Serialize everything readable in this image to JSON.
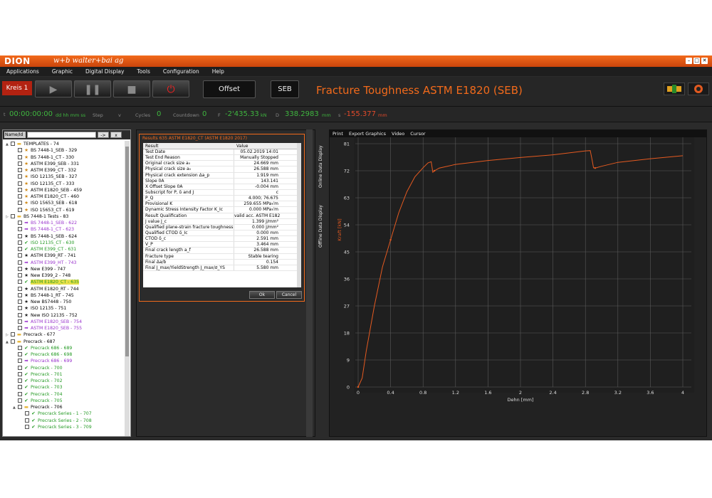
{
  "window": {
    "logo": "DION",
    "brand": "w+b  walter+bai ag"
  },
  "menu": [
    "Applications",
    "Graphic",
    "Digital Display",
    "Tools",
    "Configuration",
    "Help"
  ],
  "toolbar": {
    "kreis": "Kreis 1",
    "offset": "Offset",
    "seb": "SEB",
    "title": "Fracture Toughness ASTM E1820 (SEB)"
  },
  "status": {
    "t_label": "t",
    "time": "00:00:00:00",
    "time_unit": "dd hh mm ss",
    "step_label": "Step",
    "step_sub": "v",
    "cycles_label": "Cycles",
    "cycles": "0",
    "countdown_label": "Countdown",
    "countdown": "0",
    "f_label": "F",
    "f_value": "-2'435.33",
    "f_unit": "kN",
    "d_label": "D",
    "d_value": "338.2983",
    "d_unit": "mm",
    "s_label": "s",
    "s_value": "-155.377",
    "s_unit": "mm"
  },
  "left": {
    "search_label": "Name/Id",
    "btn_go": "->",
    "btn_clear": "x",
    "tree": [
      {
        "level": 0,
        "exp": "▲",
        "icon": "folder",
        "text": "TEMPLATES - 74",
        "color": ""
      },
      {
        "level": 1,
        "icon": "star",
        "text": "BS 7448-1_SEB - 329",
        "color": ""
      },
      {
        "level": 1,
        "icon": "star",
        "text": "BS 7448-1_CT - 330",
        "color": ""
      },
      {
        "level": 1,
        "icon": "star",
        "text": "ASTM E399_SEB - 331",
        "color": ""
      },
      {
        "level": 1,
        "icon": "star",
        "text": "ASTM E399_CT - 332",
        "color": ""
      },
      {
        "level": 1,
        "icon": "star",
        "text": "ISO 12135_SEB - 327",
        "color": ""
      },
      {
        "level": 1,
        "icon": "star",
        "text": "ISO 12135_CT - 333",
        "color": ""
      },
      {
        "level": 1,
        "icon": "star",
        "text": "ASTM E1820_SEB - 459",
        "color": ""
      },
      {
        "level": 1,
        "icon": "star",
        "text": "ASTM E1820_CT - 460",
        "color": ""
      },
      {
        "level": 1,
        "icon": "star",
        "text": "ISO 15653_SEB - 618",
        "color": ""
      },
      {
        "level": 1,
        "icon": "star",
        "text": "ISO 15653_CT - 619",
        "color": ""
      },
      {
        "level": 0,
        "exp": "▷",
        "icon": "folder",
        "text": "BS 7448-1 Tests - 83",
        "color": ""
      },
      {
        "level": 1,
        "icon": "arrow",
        "text": "BS 7448-1_SEB - 622",
        "color": "purple"
      },
      {
        "level": 1,
        "icon": "arrow",
        "text": "BS 7448-1_CT - 623",
        "color": "purple"
      },
      {
        "level": 1,
        "icon": "blackstar",
        "text": "BS 7448-1_SEB - 624",
        "color": ""
      },
      {
        "level": 1,
        "icon": "check",
        "text": "ISO 12135_CT - 630",
        "color": "green"
      },
      {
        "level": 1,
        "icon": "check",
        "text": "ASTM E399_CT - 631",
        "color": "green"
      },
      {
        "level": 1,
        "icon": "blackstar",
        "text": "ASTM E399_RT - 741",
        "color": ""
      },
      {
        "level": 1,
        "icon": "arrow",
        "text": "ASTM E399_HT - 743",
        "color": "purple"
      },
      {
        "level": 1,
        "icon": "blackstar",
        "text": "New E399 - 747",
        "color": ""
      },
      {
        "level": 1,
        "icon": "blackstar",
        "text": "New E399_2 - 748",
        "color": ""
      },
      {
        "level": 1,
        "icon": "check",
        "text": "ASTM E1820_CT - 635",
        "color": "green",
        "selected": true
      },
      {
        "level": 1,
        "icon": "blackstar",
        "text": "ASTM E1820_RT - 744",
        "color": ""
      },
      {
        "level": 1,
        "icon": "blackstar",
        "text": "BS 7448-1_RT - 745",
        "color": ""
      },
      {
        "level": 1,
        "icon": "blackstar",
        "text": "New BS7448 - 750",
        "color": ""
      },
      {
        "level": 1,
        "icon": "blackstar",
        "text": "ISO 12135 - 751",
        "color": ""
      },
      {
        "level": 1,
        "icon": "blackstar",
        "text": "New ISO 12135 - 752",
        "color": ""
      },
      {
        "level": 1,
        "icon": "arrow",
        "text": "ASTM E1820_SEB - 754",
        "color": "purple"
      },
      {
        "level": 1,
        "icon": "arrow",
        "text": "ASTM E1820_SEB - 755",
        "color": "purple"
      },
      {
        "level": 0,
        "exp": "▷",
        "icon": "folder",
        "text": "Precrack - 677",
        "color": ""
      },
      {
        "level": 0,
        "exp": "▲",
        "icon": "folder",
        "text": "Precrack - 687",
        "color": ""
      },
      {
        "level": 1,
        "icon": "check",
        "text": "Precrack 686 - 689",
        "color": "green"
      },
      {
        "level": 1,
        "icon": "check",
        "text": "Precrack 686 - 698",
        "color": "green"
      },
      {
        "level": 1,
        "icon": "arrow",
        "text": "Precrack 686 - 699",
        "color": "purple"
      },
      {
        "level": 1,
        "icon": "check",
        "text": "Precrack - 700",
        "color": "green"
      },
      {
        "level": 1,
        "icon": "check",
        "text": "Precrack - 701",
        "color": "green"
      },
      {
        "level": 1,
        "icon": "check",
        "text": "Precrack - 702",
        "color": "green"
      },
      {
        "level": 1,
        "icon": "check",
        "text": "Precrack - 703",
        "color": "green"
      },
      {
        "level": 1,
        "icon": "check",
        "text": "Precrack - 704",
        "color": "green"
      },
      {
        "level": 1,
        "icon": "check",
        "text": "Precrack - 705",
        "color": "green"
      },
      {
        "level": 1,
        "exp": "▲",
        "icon": "folder",
        "text": "Precrack - 706",
        "color": ""
      },
      {
        "level": 2,
        "icon": "check",
        "text": "Precrack Series - 1 - 707",
        "color": "green"
      },
      {
        "level": 2,
        "icon": "check",
        "text": "Precrack Series - 2 - 708",
        "color": "green"
      },
      {
        "level": 2,
        "icon": "check",
        "text": "Precrack Series - 3 - 709",
        "color": "green"
      }
    ]
  },
  "dialog": {
    "title": "Results 635 ASTM E1820_CT (ASTM E1820 2017)",
    "header": {
      "k": "Result",
      "v": "Value"
    },
    "rows": [
      {
        "k": "Test Date",
        "v": "05.02.2019 14:01"
      },
      {
        "k": "Test End Reason",
        "v": "Manually Stopped"
      },
      {
        "k": "Original crack size a₀",
        "v": "24.669 mm"
      },
      {
        "k": "Physical crack size a₀",
        "v": "26.588 mm"
      },
      {
        "k": "Physical crack extension Δa_p",
        "v": "1.919 mm"
      },
      {
        "k": "Slope 0A",
        "v": "143.141"
      },
      {
        "k": "X Offset Slope 0A",
        "v": "-0.004 mm"
      },
      {
        "k": "Subscript for P, δ and J",
        "v": "c"
      },
      {
        "k": "P_Q",
        "v": "4.000; 76.675"
      },
      {
        "k": "Provisional K",
        "v": "259.655 MPa√m"
      },
      {
        "k": "Dynamic Stress Intensity Factor K_Ic",
        "v": "0.000 MPa√m"
      },
      {
        "k": "Result Qualification",
        "v": "valid acc. ASTM E1820"
      },
      {
        "k": "J value J_c",
        "v": "1.399 J/mm²"
      },
      {
        "k": "Qualified plane-strain fracture toughness J_Ic",
        "v": "0.000 J/mm²"
      },
      {
        "k": "Qualified CTOD δ_Ic",
        "v": "0.000 mm"
      },
      {
        "k": "CTOD δ_c",
        "v": "2.591 mm"
      },
      {
        "k": "V_P",
        "v": "3.464 mm"
      },
      {
        "k": "Final crack length a_f",
        "v": "26.588 mm"
      },
      {
        "k": "Fracture type",
        "v": "Stable tearing"
      },
      {
        "k": "Final Δa/b",
        "v": "0.154"
      },
      {
        "k": "Final J_max/YieldStrength J_max/σ_YS",
        "v": "5.580 mm"
      }
    ],
    "ok": "Ok",
    "cancel": "Cancel"
  },
  "side_tabs": [
    "Online Data Display",
    "Offline Data Display"
  ],
  "graph_menu": [
    "Print",
    "Export Graphics",
    "Video",
    "Cursor"
  ],
  "chart_data": {
    "type": "line",
    "xlabel": "Dehn [mm]",
    "ylabel": "Kraft [kN]",
    "xlim": [
      0,
      4
    ],
    "ylim": [
      0,
      81
    ],
    "xticks": [
      "0",
      "0.4",
      "0.8",
      "1.2",
      "1.6",
      "2",
      "2.4",
      "2.8",
      "3.2",
      "3.6",
      "4"
    ],
    "yticks": [
      "0",
      "9",
      "18",
      "27",
      "36",
      "45",
      "54",
      "63",
      "72",
      "81"
    ],
    "grid": true,
    "color": "#e55a20",
    "series": [
      {
        "x": [
          0,
          0.05,
          0.1,
          0.2,
          0.3,
          0.4,
          0.5,
          0.6,
          0.7,
          0.8,
          0.86,
          0.9,
          0.92,
          0.94,
          1.0,
          1.2,
          1.6,
          2.0,
          2.4,
          2.8,
          2.86,
          2.88,
          2.9,
          2.92,
          3.0,
          3.2,
          3.6,
          4.0
        ],
        "y": [
          0,
          3,
          12,
          27,
          40,
          49,
          58,
          65,
          70,
          73,
          74.6,
          75,
          71.5,
          72,
          72.9,
          74.1,
          75.4,
          76.4,
          77.3,
          78.6,
          78.7,
          76,
          73,
          72.9,
          73.5,
          74.8,
          76,
          77
        ]
      }
    ]
  }
}
